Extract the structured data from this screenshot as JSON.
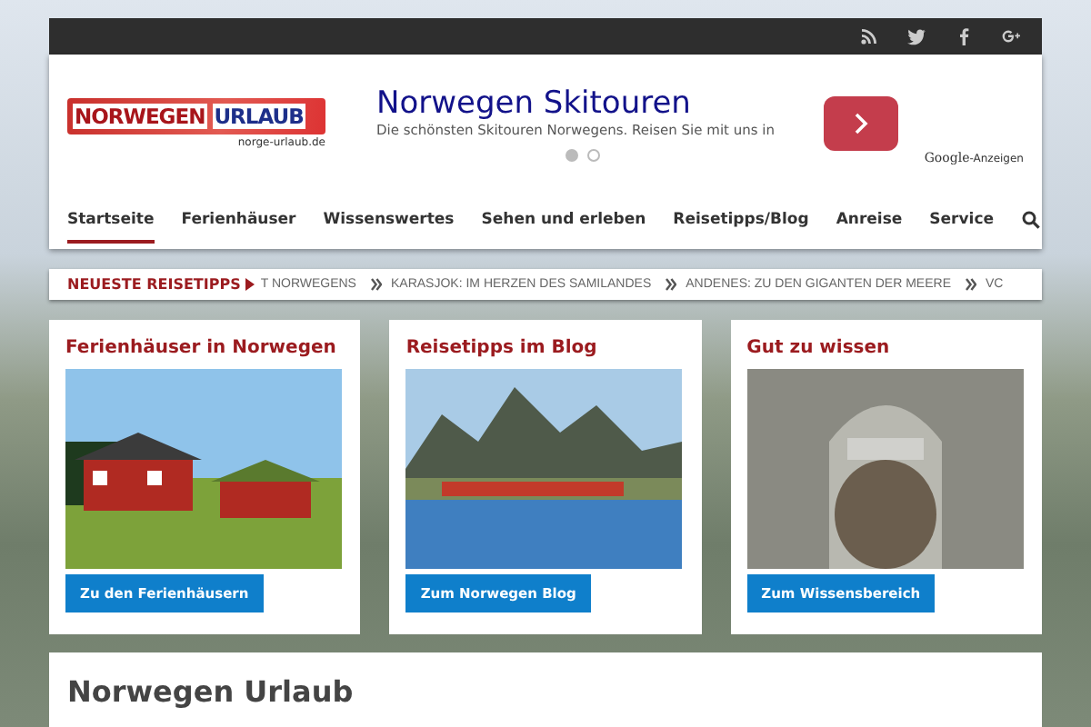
{
  "logo": {
    "word_1": "NORWEGEN",
    "word_2": "URLAUB",
    "domain": "norge-urlaub.de"
  },
  "ad": {
    "title": "Norwegen Skitouren",
    "text": "Die schönsten Skitouren Norwegens. Reisen Sie mit uns in",
    "dots": [
      {
        "selected": true
      },
      {
        "selected": false
      }
    ],
    "attribution_1": "Google",
    "attribution_2": "-Anzeigen"
  },
  "nav": {
    "items": [
      {
        "label": "Startseite",
        "selected": true
      },
      {
        "label": "Ferienhäuser",
        "selected": false
      },
      {
        "label": "Wissenswertes",
        "selected": false
      },
      {
        "label": "Sehen und erleben",
        "selected": false
      },
      {
        "label": "Reisetipps/Blog",
        "selected": false
      },
      {
        "label": "Anreise",
        "selected": false
      },
      {
        "label": "Service",
        "selected": false
      }
    ]
  },
  "ticker": {
    "label": "NEUESTE REISETIPPS",
    "items": [
      "T NORWEGENS",
      "KARASJOK: IM HERZEN DES SAMILANDES",
      "ANDENES: ZU DEN GIGANTEN DER MEERE",
      "VC"
    ]
  },
  "cards": [
    {
      "title": "Ferienhäuser in Norwegen",
      "kind": "house",
      "button": "Zu den Ferienhäusern"
    },
    {
      "title": "Reisetipps im Blog",
      "kind": "fjord",
      "button": "Zum Norwegen Blog"
    },
    {
      "title": "Gut zu wissen",
      "kind": "viking",
      "button": "Zum Wissensbereich"
    }
  ],
  "content": {
    "title": "Norwegen Urlaub"
  }
}
